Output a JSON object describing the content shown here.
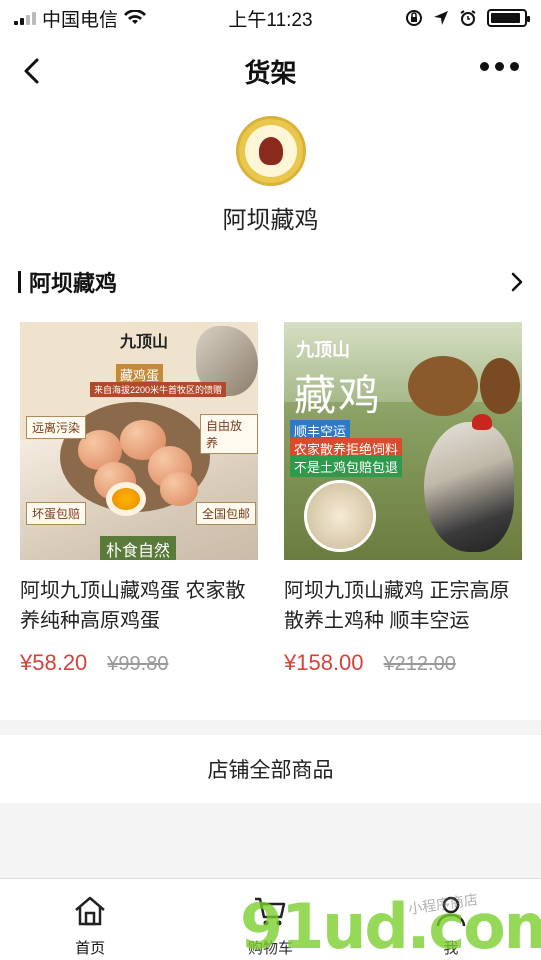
{
  "status_bar": {
    "carrier": "中国电信",
    "time": "上午11:23",
    "battery_level": 0.9
  },
  "nav": {
    "title": "货架"
  },
  "shop": {
    "name": "阿坝藏鸡",
    "logo_text": "CHICKEN ROYAL"
  },
  "section": {
    "title": "阿坝藏鸡"
  },
  "products": [
    {
      "name": "阿坝九顶山藏鸡蛋 农家散养纯种高原鸡蛋",
      "price": "¥58.20",
      "original_price": "¥99.80",
      "image": {
        "brand": "九顶山",
        "brand_sub": "藏鸡蛋",
        "banner": "来自海拔2200米牛首牧区的馈赠",
        "tags": [
          "远离污染",
          "自由放养",
          "坏蛋包赔",
          "全国包邮"
        ],
        "motto": "朴食自然"
      }
    },
    {
      "name": "阿坝九顶山藏鸡 正宗高原散养土鸡种 顺丰空运",
      "price": "¥158.00",
      "original_price": "¥212.00",
      "image": {
        "brand": "九顶山",
        "big_text": "藏鸡",
        "labels": [
          "顺丰空运",
          "农家散养拒绝饲料",
          "不是土鸡包赔包退"
        ]
      }
    }
  ],
  "all_products_label": "店铺全部商品",
  "tabs": [
    {
      "label": "首页",
      "icon": "home-icon"
    },
    {
      "label": "购物车",
      "icon": "cart-icon"
    },
    {
      "label": "我",
      "icon": "person-icon"
    }
  ],
  "watermark": {
    "main": "91ud.com",
    "sub": "小程序商店"
  },
  "colors": {
    "price": "#d9413b",
    "original_price": "#999999",
    "background": "#f4f4f4",
    "watermark": "#78cd28"
  }
}
